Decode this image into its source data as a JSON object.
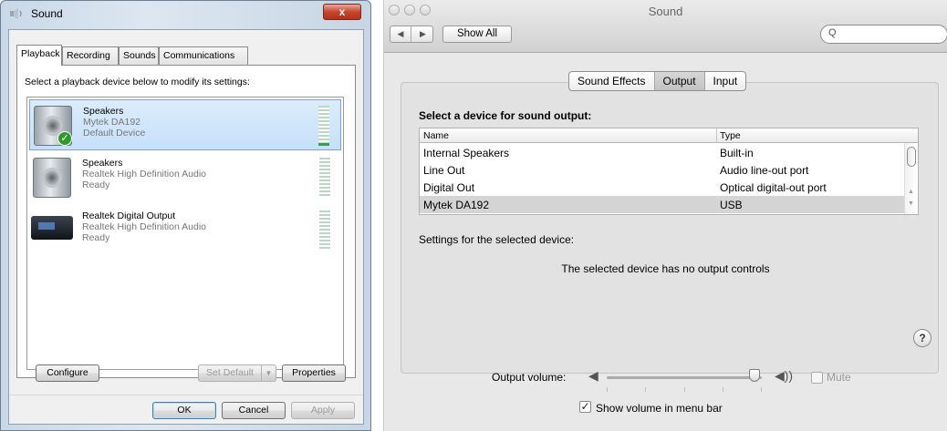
{
  "win": {
    "title": "Sound",
    "close_label": "x",
    "tabs": [
      "Playback",
      "Recording",
      "Sounds",
      "Communications"
    ],
    "prompt": "Select a playback device below to modify its settings:",
    "devices": [
      {
        "name": "Speakers",
        "sub": "Mytek DA192",
        "status": "Default Device",
        "icon": "speaker-icon",
        "default": true
      },
      {
        "name": "Speakers",
        "sub": "Realtek High Definition Audio",
        "status": "Ready",
        "icon": "speaker-icon",
        "default": false
      },
      {
        "name": "Realtek Digital Output",
        "sub": "Realtek High Definition Audio",
        "status": "Ready",
        "icon": "digital-output-icon",
        "default": false
      }
    ],
    "buttons": {
      "configure": "Configure",
      "set_default": "Set Default",
      "properties": "Properties",
      "ok": "OK",
      "cancel": "Cancel",
      "apply": "Apply"
    },
    "check_mark": "✓",
    "dropdown_glyph": "▼"
  },
  "mac": {
    "title": "Sound",
    "back_glyph": "◀",
    "forward_glyph": "▶",
    "show_all": "Show All",
    "search_glyph": "Q",
    "segments": [
      "Sound Effects",
      "Output",
      "Input"
    ],
    "active_segment": "Output",
    "heading": "Select a device for sound output:",
    "columns": [
      "Name",
      "Type"
    ],
    "rows": [
      {
        "name": "Internal Speakers",
        "type": "Built-in"
      },
      {
        "name": "Line Out",
        "type": "Audio line-out port"
      },
      {
        "name": "Digital Out",
        "type": "Optical digital-out port"
      },
      {
        "name": "Mytek  DA192",
        "type": "USB"
      }
    ],
    "selected_row": "Mytek  DA192",
    "settings_label": "Settings for the selected device:",
    "no_controls": "The selected device has no output controls",
    "help": "?",
    "volume_label": "Output volume:",
    "volume_level": 0.95,
    "speaker_low_glyph": "◀",
    "speaker_high_glyph": "◀))",
    "mute_label": "Mute",
    "mute_checked": false,
    "show_menu_label": "Show volume in menu bar",
    "show_menu_checked": true,
    "check_glyph": "✓",
    "scroll_up": "▲",
    "scroll_down": "▼"
  },
  "colors": {
    "win_selection": "#c5e0fa",
    "win_close": "#c8452c",
    "check_green": "#2e9a2e",
    "mac_selected_row": "#d4d4d4"
  }
}
